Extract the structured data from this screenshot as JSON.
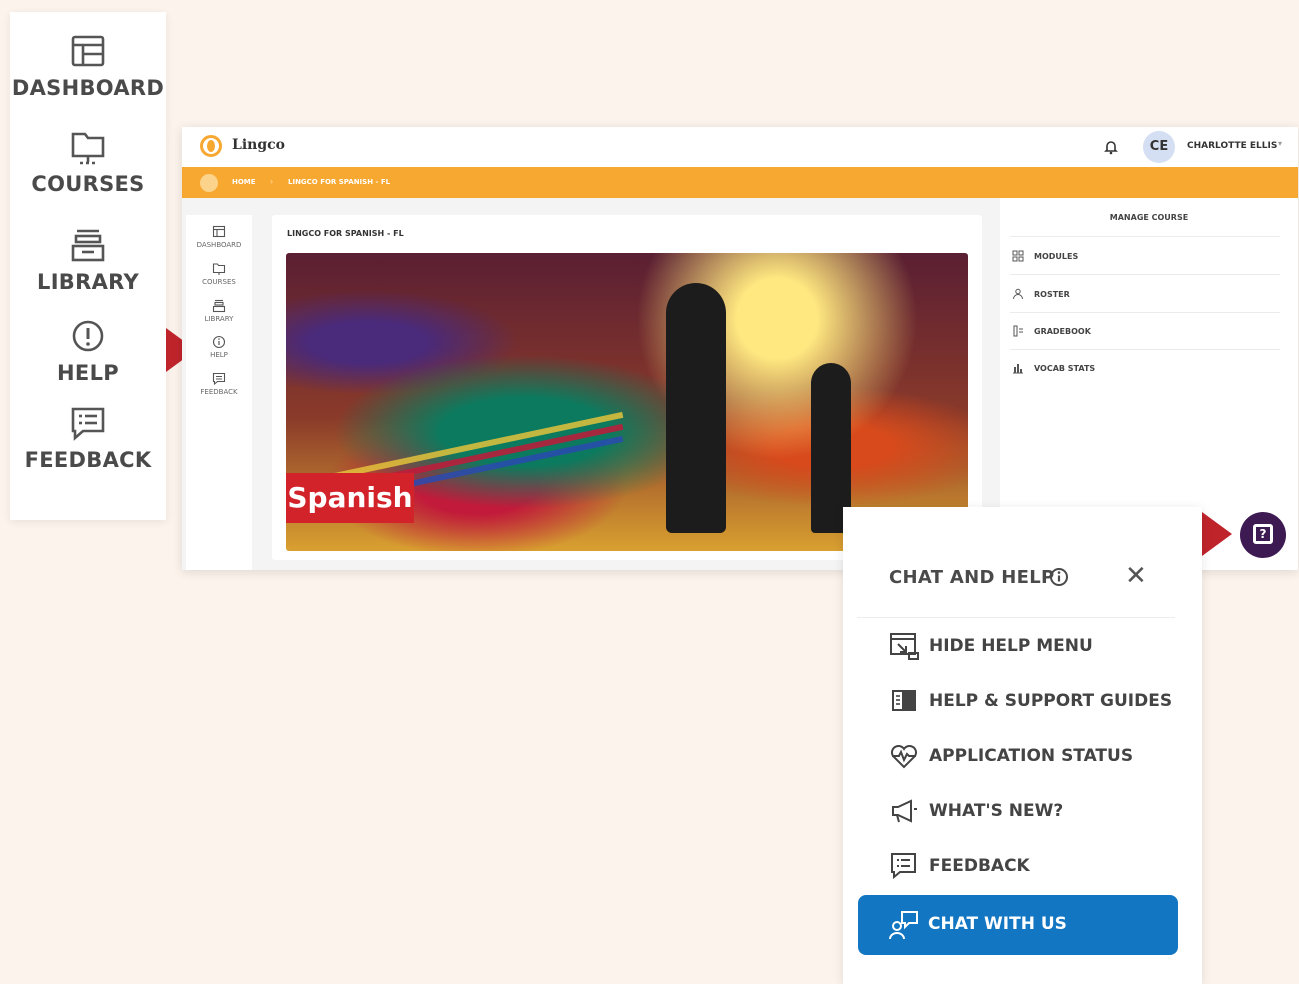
{
  "big_sidebar": {
    "items": [
      {
        "label": "DASHBOARD",
        "icon": "dashboard-icon"
      },
      {
        "label": "COURSES",
        "icon": "monitor-icon"
      },
      {
        "label": "LIBRARY",
        "icon": "library-icon"
      },
      {
        "label": "HELP",
        "icon": "alert-circle-icon"
      },
      {
        "label": "FEEDBACK",
        "icon": "feedback-icon"
      }
    ]
  },
  "app": {
    "logo_text": "Lingco",
    "user": {
      "initials": "CE",
      "name": "CHARLOTTE ELLIS"
    },
    "breadcrumb": {
      "home": "HOME",
      "current": "LINGCO FOR SPANISH - FL"
    },
    "sidebar": {
      "items": [
        {
          "label": "DASHBOARD"
        },
        {
          "label": "COURSES"
        },
        {
          "label": "LIBRARY"
        },
        {
          "label": "HELP"
        },
        {
          "label": "FEEDBACK"
        }
      ]
    },
    "course": {
      "title": "LINGCO FOR SPANISH - FL",
      "banner_label": "Spanish"
    },
    "manage": {
      "title": "MANAGE COURSE",
      "items": [
        {
          "label": "MODULES"
        },
        {
          "label": "ROSTER"
        },
        {
          "label": "GRADEBOOK"
        },
        {
          "label": "VOCAB STATS"
        }
      ]
    },
    "help_fab_glyph": "?"
  },
  "help_popover": {
    "title": "CHAT AND HELP",
    "close": "✕",
    "items": [
      {
        "label": "HIDE HELP MENU"
      },
      {
        "label": "HELP & SUPPORT GUIDES"
      },
      {
        "label": "APPLICATION STATUS"
      },
      {
        "label": "WHAT'S NEW?"
      },
      {
        "label": "FEEDBACK"
      }
    ],
    "chat_button": "CHAT WITH US"
  },
  "colors": {
    "accent_orange": "#f7a830",
    "pointer_red": "#c0242b",
    "chat_blue": "#1376c2",
    "fab_purple": "#3d1a52",
    "banner_red": "#d2232a",
    "background": "#fcf4ec"
  }
}
